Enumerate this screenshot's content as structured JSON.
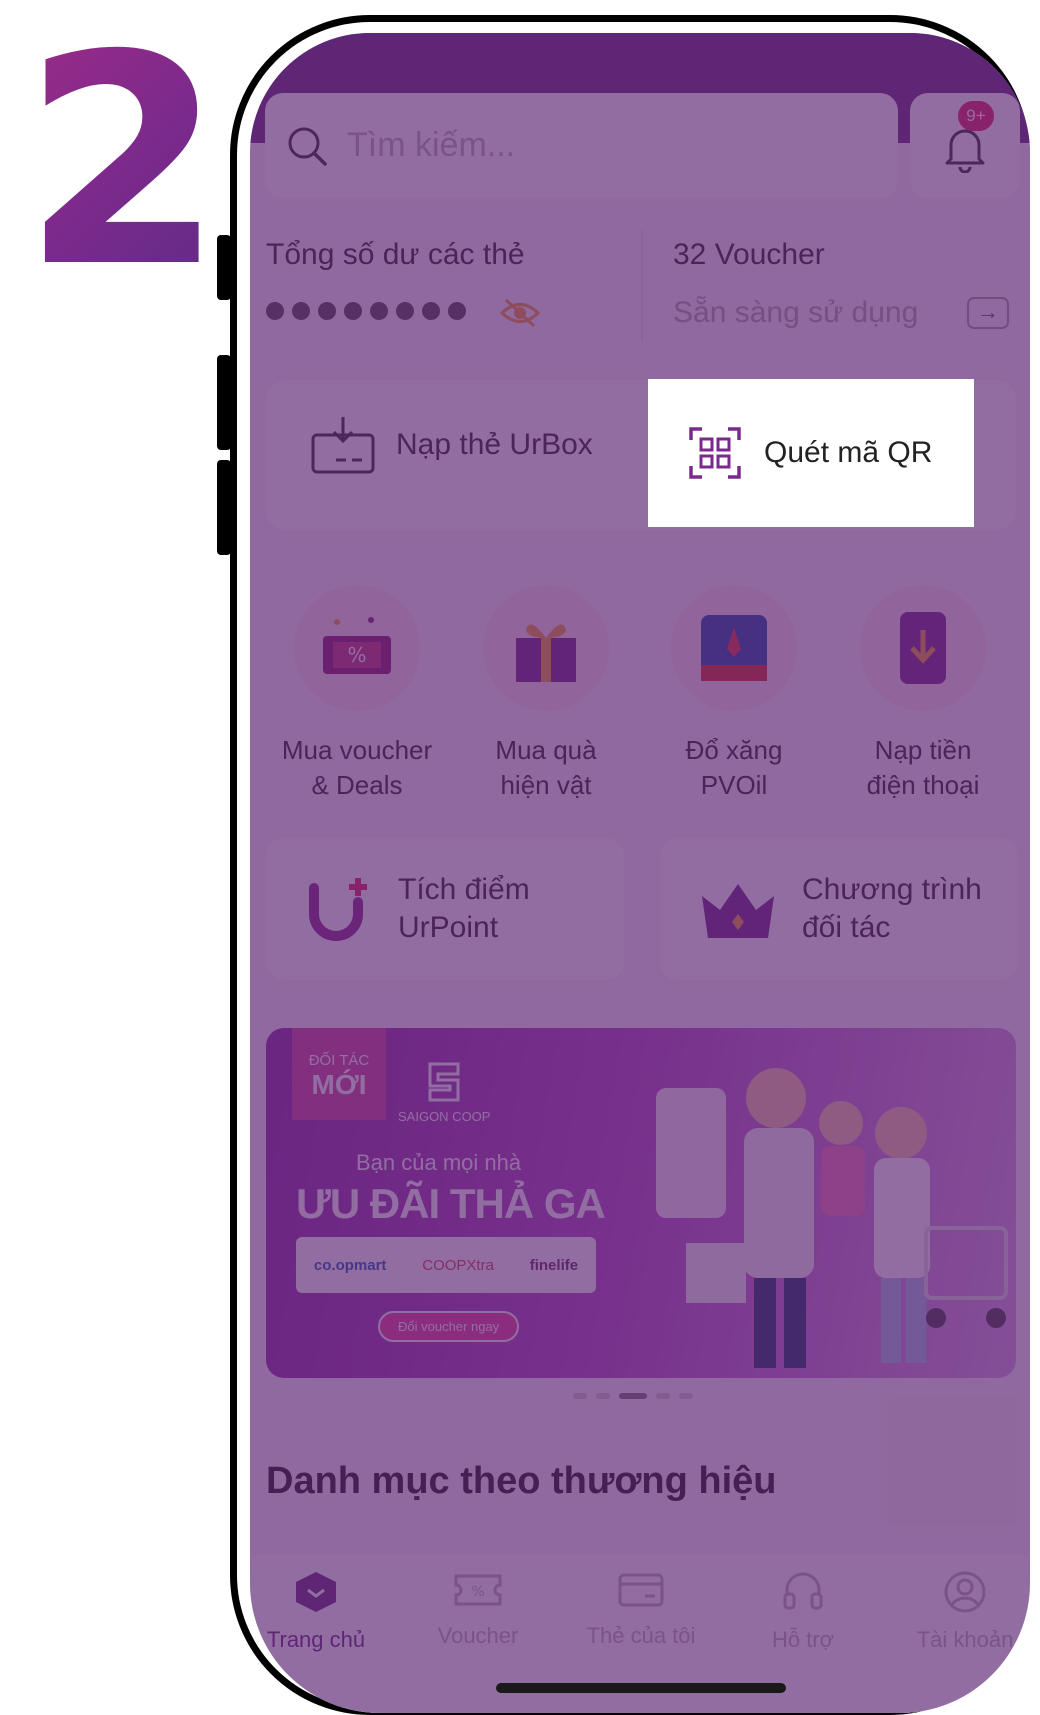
{
  "step": {
    "number": "2"
  },
  "search": {
    "placeholder": "Tìm kiếm..."
  },
  "notifications": {
    "badge": "9+"
  },
  "balance": {
    "label": "Tổng số dư các thẻ",
    "masked": "••••••••"
  },
  "vouchers": {
    "count_label": "32 Voucher",
    "status": "Sẵn sàng sử dụng"
  },
  "actions": {
    "topup_label": "Nạp thẻ UrBox",
    "scan_qr_label": "Quét mã QR"
  },
  "services": [
    {
      "label": "Mua voucher\n& Deals",
      "icon": "voucher-icon"
    },
    {
      "label": "Mua quà\nhiện vật",
      "icon": "gift-icon"
    },
    {
      "label": "Đổ xăng\nPVOil",
      "icon": "pvoil-icon"
    },
    {
      "label": "Nạp tiền\nđiện thoại",
      "icon": "phone-topup-icon"
    }
  ],
  "features": [
    {
      "label": "Tích điểm\nUrPoint",
      "icon": "urpoint-icon"
    },
    {
      "label": "Chương trình\nđối tác",
      "icon": "crown-icon"
    }
  ],
  "banner": {
    "tag_small": "ĐỐI TÁC",
    "tag_big": "MỚI",
    "brand": "SAIGON COOP",
    "subtitle": "Bạn của mọi nhà",
    "title": "ƯU ĐÃI THẢ GA",
    "logos": [
      "co.opmart",
      "COOPXtra",
      "finelife"
    ],
    "cta": "Đổi voucher ngay"
  },
  "carousel": {
    "count": 5,
    "active": 2
  },
  "section": {
    "title": "Danh mục theo thương hiệu"
  },
  "tabbar": {
    "tabs": [
      {
        "label": "Trang chủ",
        "icon": "home-icon",
        "active": true
      },
      {
        "label": "Voucher",
        "icon": "voucher-tab-icon",
        "active": false
      },
      {
        "label": "Thẻ của tôi",
        "icon": "card-icon",
        "active": false
      },
      {
        "label": "Hỗ trợ",
        "icon": "headset-icon",
        "active": false
      },
      {
        "label": "Tài khoản",
        "icon": "user-icon",
        "active": false
      }
    ]
  },
  "colors": {
    "brand_purple": "#6a2f82",
    "overlay": "rgba(89,34,112,0.66)",
    "badge": "#e0245e"
  }
}
